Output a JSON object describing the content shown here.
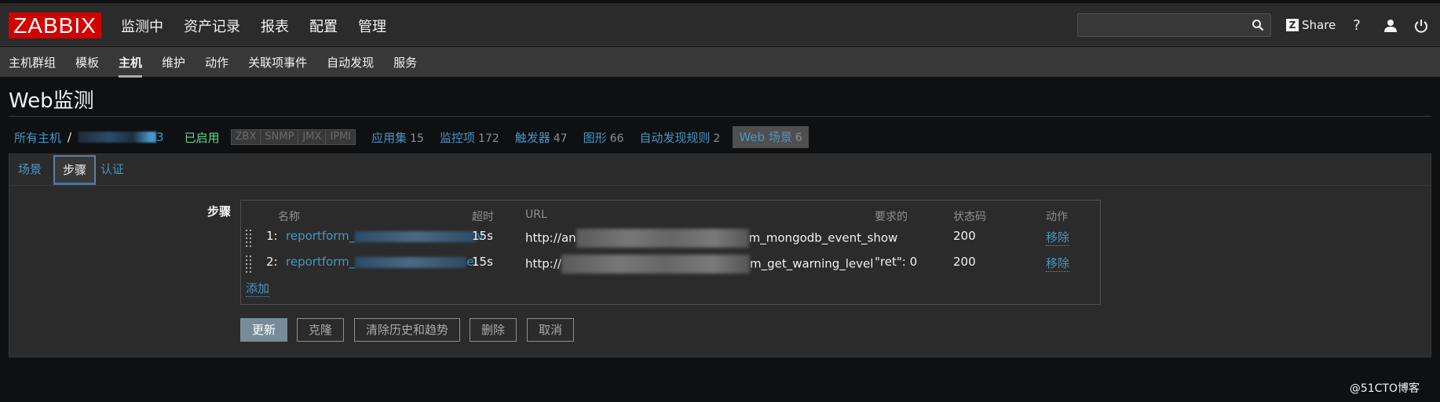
{
  "brand": {
    "logo": "ZABBIX"
  },
  "main_menu": [
    "监测中",
    "资产记录",
    "报表",
    "配置",
    "管理"
  ],
  "header": {
    "share_label": "Share",
    "help_label": "?"
  },
  "sub_menu": [
    "主机群组",
    "模板",
    "主机",
    "维护",
    "动作",
    "关联项事件",
    "自动发现",
    "服务"
  ],
  "page_title": "Web监测",
  "breadcrumb": {
    "all_hosts": "所有主机",
    "separator": "/",
    "host_suffix": "3",
    "status": "已启用",
    "availability": [
      "ZBX",
      "SNMP",
      "JMX",
      "IPMI"
    ],
    "items": [
      {
        "label": "应用集",
        "count": "15"
      },
      {
        "label": "监控项",
        "count": "172"
      },
      {
        "label": "触发器",
        "count": "47"
      },
      {
        "label": "图形",
        "count": "66"
      },
      {
        "label": "自动发现规则",
        "count": "2"
      },
      {
        "label": "Web 场景",
        "count": "6"
      }
    ]
  },
  "tabs": [
    "场景",
    "步骤",
    "认证"
  ],
  "form": {
    "steps_label": "步骤",
    "columns": [
      "名称",
      "超时",
      "URL",
      "要求的",
      "状态码",
      "动作"
    ],
    "rows": [
      {
        "index": "1:",
        "name_prefix": "reportform_",
        "name_suffix": "v",
        "timeout": "15s",
        "url_prefix": "http://an",
        "url_suffix": "m_mongodb_event_show",
        "required": "",
        "status_code": "200",
        "action": "移除"
      },
      {
        "index": "2:",
        "name_prefix": "reportform_",
        "name_suffix": "el",
        "timeout": "15s",
        "url_prefix": "http://",
        "url_suffix": "m_get_warning_level",
        "required": "\"ret\": 0",
        "status_code": "200",
        "action": "移除"
      }
    ],
    "add_label": "添加"
  },
  "buttons": [
    "更新",
    "克隆",
    "清除历史和趋势",
    "删除",
    "取消"
  ],
  "watermark": "@51CTO博客"
}
